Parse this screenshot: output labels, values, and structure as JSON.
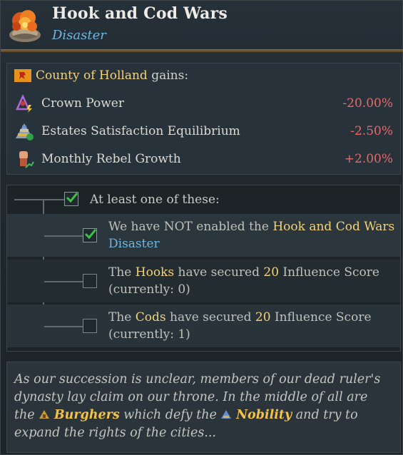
{
  "header": {
    "title": "Hook and Cod Wars",
    "subtitle": "Disaster",
    "icon": "explosion-icon"
  },
  "effects": {
    "country": "County of Holland",
    "gains_suffix": " gains:",
    "rows": [
      {
        "label": "Crown Power",
        "value": "-20.00%",
        "icon": "crown-power-icon"
      },
      {
        "label": "Estates Satisfaction Equilibrium",
        "value": "-2.50%",
        "icon": "estates-pyramid-icon"
      },
      {
        "label": "Monthly Rebel Growth",
        "value": "+2.00%",
        "icon": "rebel-fist-icon"
      }
    ],
    "value_color": "#e46b6b"
  },
  "triggers": {
    "root_label": "At least one of these:",
    "items": [
      {
        "pre": "We have NOT enabled the ",
        "hl": "Hook and Cod Wars",
        "line2": "Disaster",
        "checked": true
      },
      {
        "pre": "The ",
        "name": "Hooks",
        "mid": " have secured ",
        "num": "20",
        "post": " Influence Score",
        "line2": "(currently: 0)",
        "checked": false
      },
      {
        "pre": "The ",
        "name": "Cods",
        "mid": " have secured ",
        "num": "20",
        "post": " Influence Score",
        "line2": "(currently: 1)",
        "checked": false
      }
    ]
  },
  "flavor": {
    "t1": "As our succession is unclear, members of our dead ruler's dynasty lay claim on our throne. In the middle of all are the ",
    "burghers": "Burghers",
    "t2": " which defy the ",
    "nobility": "Nobility",
    "t3": " and try to expand the rights of the cities..."
  },
  "colors": {
    "accent_gold": "#f2d27a",
    "accent_blue": "#6fb6e0",
    "negative": "#e46b6b"
  }
}
